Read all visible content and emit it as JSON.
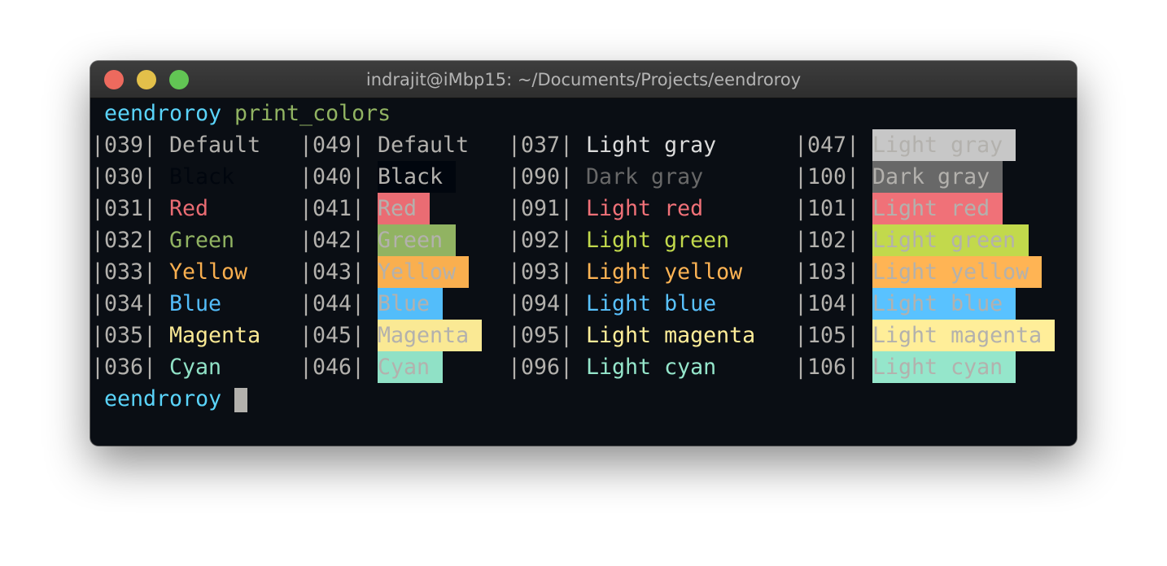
{
  "window": {
    "title": "indrajit@iMbp15: ~/Documents/Projects/eendroroy",
    "traffic_lights": {
      "close": "#ed6a5e",
      "minimize": "#e3c04a",
      "zoom": "#62c554"
    }
  },
  "terminal": {
    "background": "#0a0e14",
    "default_fg": "#b3b1ad",
    "prompt": {
      "user": "eendroroy",
      "command": "print_colors",
      "user_color": "#5ad4fa",
      "command_color": "#91b362"
    },
    "final_prompt": {
      "user": "eendroroy"
    },
    "rows": [
      [
        {
          "code": "|039|",
          "label": "Default"
        },
        {
          "code": "|049|",
          "label": "Default"
        },
        {
          "code": "|037|",
          "label": "Light gray",
          "fg": "#dcdcdc"
        },
        {
          "code": "|047|",
          "label": "Light gray",
          "bg": "#c7c7c7"
        }
      ],
      [
        {
          "code": "|030|",
          "label": "Black",
          "fg": "#01060e"
        },
        {
          "code": "|040|",
          "label": "Black",
          "bg": "#01060e"
        },
        {
          "code": "|090|",
          "label": "Dark gray",
          "fg": "#686868"
        },
        {
          "code": "|100|",
          "label": "Dark gray",
          "bg": "#686868"
        }
      ],
      [
        {
          "code": "|031|",
          "label": "Red",
          "fg": "#ea6c73"
        },
        {
          "code": "|041|",
          "label": "Red",
          "bg": "#ea6c73"
        },
        {
          "code": "|091|",
          "label": "Light red",
          "fg": "#f07178"
        },
        {
          "code": "|101|",
          "label": "Light red",
          "bg": "#f07178"
        }
      ],
      [
        {
          "code": "|032|",
          "label": "Green",
          "fg": "#91b362"
        },
        {
          "code": "|042|",
          "label": "Green",
          "bg": "#91b362"
        },
        {
          "code": "|092|",
          "label": "Light green",
          "fg": "#c2d94c"
        },
        {
          "code": "|102|",
          "label": "Light green",
          "bg": "#c2d94c"
        }
      ],
      [
        {
          "code": "|033|",
          "label": "Yellow",
          "fg": "#f9af4f"
        },
        {
          "code": "|043|",
          "label": "Yellow",
          "bg": "#f9af4f"
        },
        {
          "code": "|093|",
          "label": "Light yellow",
          "fg": "#ffb454"
        },
        {
          "code": "|103|",
          "label": "Light yellow",
          "bg": "#ffb454"
        }
      ],
      [
        {
          "code": "|034|",
          "label": "Blue",
          "fg": "#53bdfa"
        },
        {
          "code": "|044|",
          "label": "Blue",
          "bg": "#53bdfa"
        },
        {
          "code": "|094|",
          "label": "Light blue",
          "fg": "#59c2ff"
        },
        {
          "code": "|104|",
          "label": "Light blue",
          "bg": "#59c2ff"
        }
      ],
      [
        {
          "code": "|035|",
          "label": "Magenta",
          "fg": "#fae994"
        },
        {
          "code": "|045|",
          "label": "Magenta",
          "bg": "#fae994"
        },
        {
          "code": "|095|",
          "label": "Light magenta",
          "fg": "#ffee99"
        },
        {
          "code": "|105|",
          "label": "Light magenta",
          "bg": "#ffee99"
        }
      ],
      [
        {
          "code": "|036|",
          "label": "Cyan",
          "fg": "#90e1c6"
        },
        {
          "code": "|046|",
          "label": "Cyan",
          "bg": "#90e1c6"
        },
        {
          "code": "|096|",
          "label": "Light cyan",
          "fg": "#95e6cb"
        },
        {
          "code": "|106|",
          "label": "Light cyan",
          "bg": "#95e6cb"
        }
      ]
    ]
  }
}
